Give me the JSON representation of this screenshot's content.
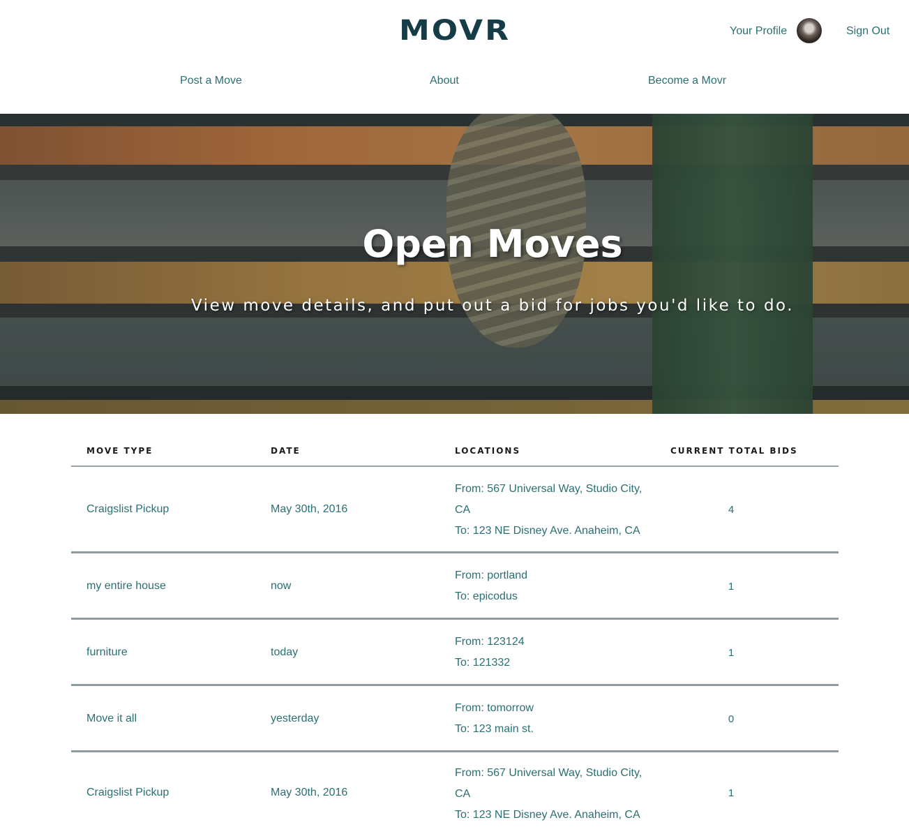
{
  "header": {
    "logo": "MOVR",
    "profile_label": "Your Profile",
    "signout_label": "Sign Out"
  },
  "nav": {
    "post": "Post a Move",
    "about": "About",
    "become": "Become a Movr"
  },
  "hero": {
    "title": "Open Moves",
    "subtitle": "View move details, and put out a bid for jobs you'd like to do."
  },
  "table": {
    "headers": {
      "type": "MOVE TYPE",
      "date": "DATE",
      "locations": "LOCATIONS",
      "bids": "CURRENT TOTAL BIDS"
    },
    "rows": [
      {
        "type": "Craigslist Pickup",
        "date": "May 30th, 2016",
        "from": "From: 567 Universal Way, Studio City, CA",
        "to": "To: 123 NE Disney Ave. Anaheim, CA",
        "bids": "4"
      },
      {
        "type": "my entire house",
        "date": "now",
        "from": "From: portland",
        "to": "To: epicodus",
        "bids": "1"
      },
      {
        "type": "furniture",
        "date": "today",
        "from": "From: 123124",
        "to": "To: 121332",
        "bids": "1"
      },
      {
        "type": "Move it all",
        "date": "yesterday",
        "from": "From: tomorrow",
        "to": "To: 123 main st.",
        "bids": "0"
      },
      {
        "type": "Craigslist Pickup",
        "date": "May 30th, 2016",
        "from": "From: 567 Universal Way, Studio City, CA",
        "to": "To: 123 NE Disney Ave. Anaheim, CA",
        "bids": "1"
      }
    ]
  }
}
